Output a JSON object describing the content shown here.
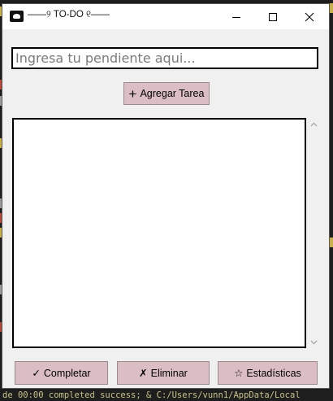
{
  "window": {
    "title": "——୨ TO-DO ୧——",
    "controls": {
      "minimize": "minimize",
      "maximize": "maximize",
      "close": "close"
    }
  },
  "task_input": {
    "placeholder": "Ingresa tu pendiente aqui...",
    "value": ""
  },
  "buttons": {
    "add": {
      "icon": "+",
      "label": "Agregar Tarea"
    },
    "complete": {
      "icon": "✓",
      "label": "Completar"
    },
    "delete": {
      "icon": "✗",
      "label": "Eliminar"
    },
    "stats": {
      "icon": "☆",
      "label": "Estadísticas"
    }
  },
  "task_list": {
    "items": []
  },
  "colors": {
    "button_bg": "#dbbec3",
    "window_bg": "#f0f0f0",
    "list_border": "#000000"
  }
}
